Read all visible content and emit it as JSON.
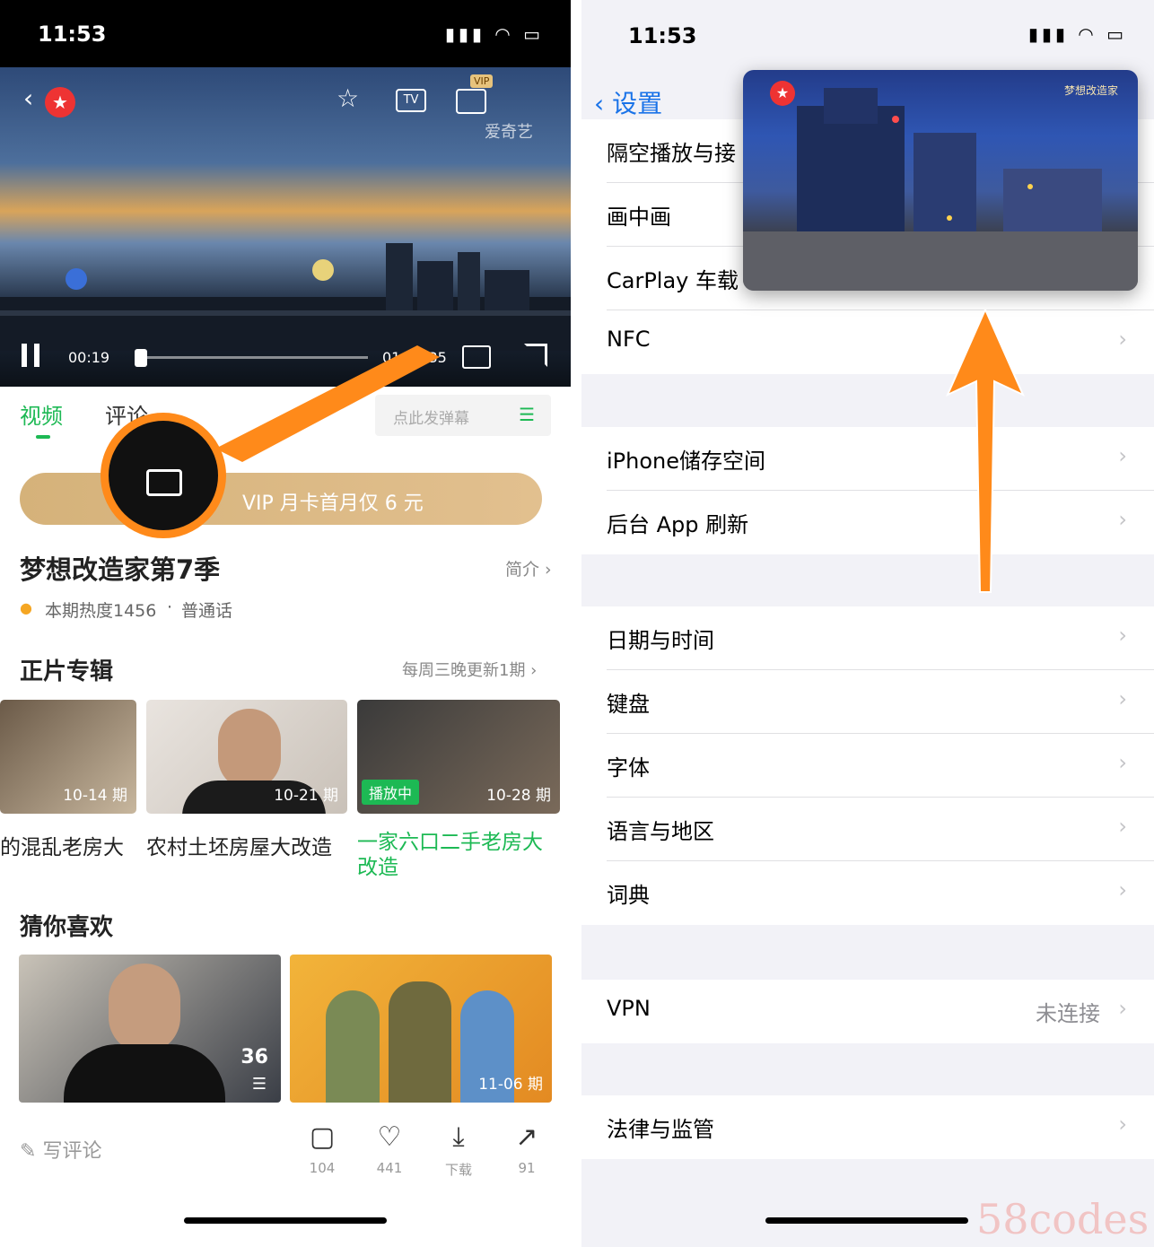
{
  "left": {
    "status": {
      "time": "11:53"
    },
    "player": {
      "current_time": "00:19",
      "total_time": "01:15:35",
      "logo_text": "爱奇艺",
      "vip_badge": "VIP",
      "icons": [
        "back-icon",
        "star-icon",
        "tv-icon",
        "pip-icon",
        "fullscreen-icon"
      ]
    },
    "tabs": [
      {
        "label": "视频",
        "active": true
      },
      {
        "label": "评论",
        "active": false
      }
    ],
    "danmu_placeholder": "点此发弹幕",
    "vip_banner": "VIP 月卡首月仅 6 元",
    "show": {
      "title": "梦想改造家第7季",
      "intro_link": "简介",
      "heat": "本期热度1456",
      "language": "普通话"
    },
    "episodes_section": {
      "title": "正片专辑",
      "update_note": "每周三晚更新1期",
      "episodes": [
        {
          "date": "10-14 期",
          "caption": "的混乱老房大",
          "playing": false
        },
        {
          "date": "10-21 期",
          "caption": "农村土坯房屋大改造",
          "playing": false
        },
        {
          "date": "10-28 期",
          "caption": "一家六口二手老房大改造",
          "playing": true,
          "playing_label": "播放中"
        }
      ]
    },
    "recommend": {
      "title": "猜你喜欢",
      "items": [
        {
          "badge": "36"
        },
        {
          "badge": "11-06 期"
        }
      ]
    },
    "bottom_bar": {
      "comment_label": "写评论",
      "actions": [
        {
          "icon": "comment-icon",
          "count": "104"
        },
        {
          "icon": "heart-icon",
          "count": "441"
        },
        {
          "icon": "download-icon",
          "count": "下载"
        },
        {
          "icon": "share-icon",
          "count": "91"
        }
      ]
    }
  },
  "right": {
    "status": {
      "time": "11:53"
    },
    "nav": {
      "back_label": "设置"
    },
    "groups": [
      [
        {
          "label": "隔空播放与接"
        },
        {
          "label": "画中画"
        },
        {
          "label": "CarPlay 车载"
        },
        {
          "label": "NFC"
        }
      ],
      [
        {
          "label": "iPhone储存空间"
        },
        {
          "label": "后台 App 刷新"
        }
      ],
      [
        {
          "label": "日期与时间"
        },
        {
          "label": "键盘"
        },
        {
          "label": "字体"
        },
        {
          "label": "语言与地区"
        },
        {
          "label": "词典"
        }
      ],
      [
        {
          "label": "VPN",
          "value": "未连接"
        }
      ],
      [
        {
          "label": "法律与监管"
        }
      ]
    ],
    "pip_logo": "梦想改造家"
  },
  "watermark": "58codes",
  "colors": {
    "accent_green": "#1db954",
    "ios_blue": "#1a73e8",
    "annotation_orange": "#ff8a1a",
    "vip_gold": "#d5b27a"
  }
}
